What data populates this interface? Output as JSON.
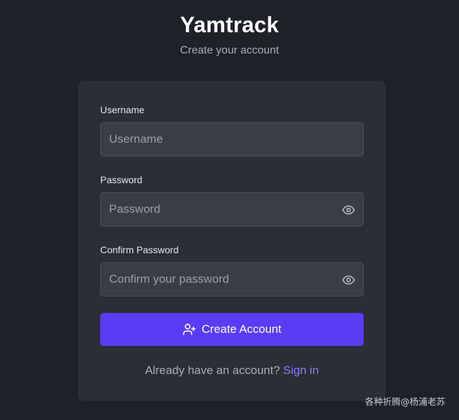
{
  "header": {
    "app_name": "Yamtrack",
    "subtitle": "Create your account"
  },
  "form": {
    "username": {
      "label": "Username",
      "placeholder": "Username",
      "value": ""
    },
    "password": {
      "label": "Password",
      "placeholder": "Password",
      "value": "",
      "toggle_icon": "eye-icon"
    },
    "confirm_password": {
      "label": "Confirm Password",
      "placeholder": "Confirm your password",
      "value": "",
      "toggle_icon": "eye-icon"
    },
    "submit": {
      "label": "Create Account",
      "icon": "user-plus-icon"
    }
  },
  "footer": {
    "prompt": "Already have an account?",
    "link_label": "Sign in"
  },
  "watermark": {
    "text": "各种折腾@杨浦老苏"
  },
  "colors": {
    "background": "#1e2127",
    "card": "#2a2e36",
    "input": "#383d48",
    "accent": "#5b3cf5",
    "link": "#8b7dfc"
  }
}
